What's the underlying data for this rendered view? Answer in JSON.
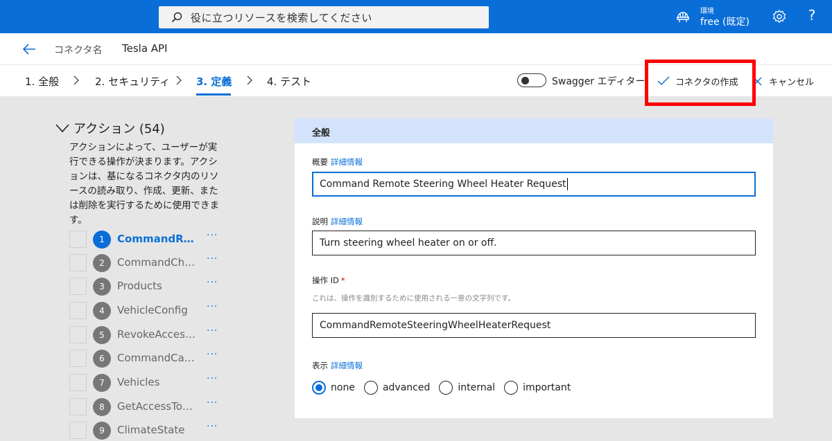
{
  "topbar": {
    "search_placeholder": "役に立つリソースを検索してください",
    "env_label": "環境",
    "env_value": "free (既定)",
    "help": "?"
  },
  "titlebar": {
    "connector_label": "コネクタ名",
    "connector_name": "Tesla API"
  },
  "steps": [
    {
      "label": "1. 全般"
    },
    {
      "label": "2. セキュリティ"
    },
    {
      "label": "3. 定義"
    },
    {
      "label": "4. テスト"
    }
  ],
  "toolbar": {
    "swagger_label": "Swagger エディター",
    "create_label": "コネクタの作成",
    "cancel_label": "キャンセル"
  },
  "actions": {
    "title": "アクション (54)",
    "description": "アクションによって、ユーザーが実行できる操作が決まります。アクションは、基になるコネクタ内のリソースの読み取り、作成、更新、または削除を実行するために使用できます。",
    "more": "···",
    "items": [
      {
        "num": "1",
        "name": "CommandRe…"
      },
      {
        "num": "2",
        "name": "CommandCha…"
      },
      {
        "num": "3",
        "name": "Products"
      },
      {
        "num": "4",
        "name": "VehicleConfig"
      },
      {
        "num": "5",
        "name": "RevokeAcces…"
      },
      {
        "num": "6",
        "name": "CommandCan…"
      },
      {
        "num": "7",
        "name": "Vehicles"
      },
      {
        "num": "8",
        "name": "GetAccessTo…"
      },
      {
        "num": "9",
        "name": "ClimateState"
      }
    ]
  },
  "general": {
    "title": "全般",
    "summary_label": "概要",
    "summary_link": "詳細情報",
    "summary_value": "Command Remote Steering Wheel Heater Request",
    "desc_label": "説明",
    "desc_link": "詳細情報",
    "desc_value": "Turn steering wheel heater on or off.",
    "opid_label": "操作 ID",
    "opid_required": "*",
    "opid_hint": "これは、操作を識別するために使用される一意の文字列です。",
    "opid_value": "CommandRemoteSteeringWheelHeaterRequest",
    "visibility_label": "表示",
    "visibility_link": "詳細情報",
    "visibility_options": [
      "none",
      "advanced",
      "internal",
      "important"
    ],
    "visibility_selected": "none"
  },
  "colors": {
    "accent": "#0a6ed8",
    "highlight_box": "#ff0000"
  }
}
